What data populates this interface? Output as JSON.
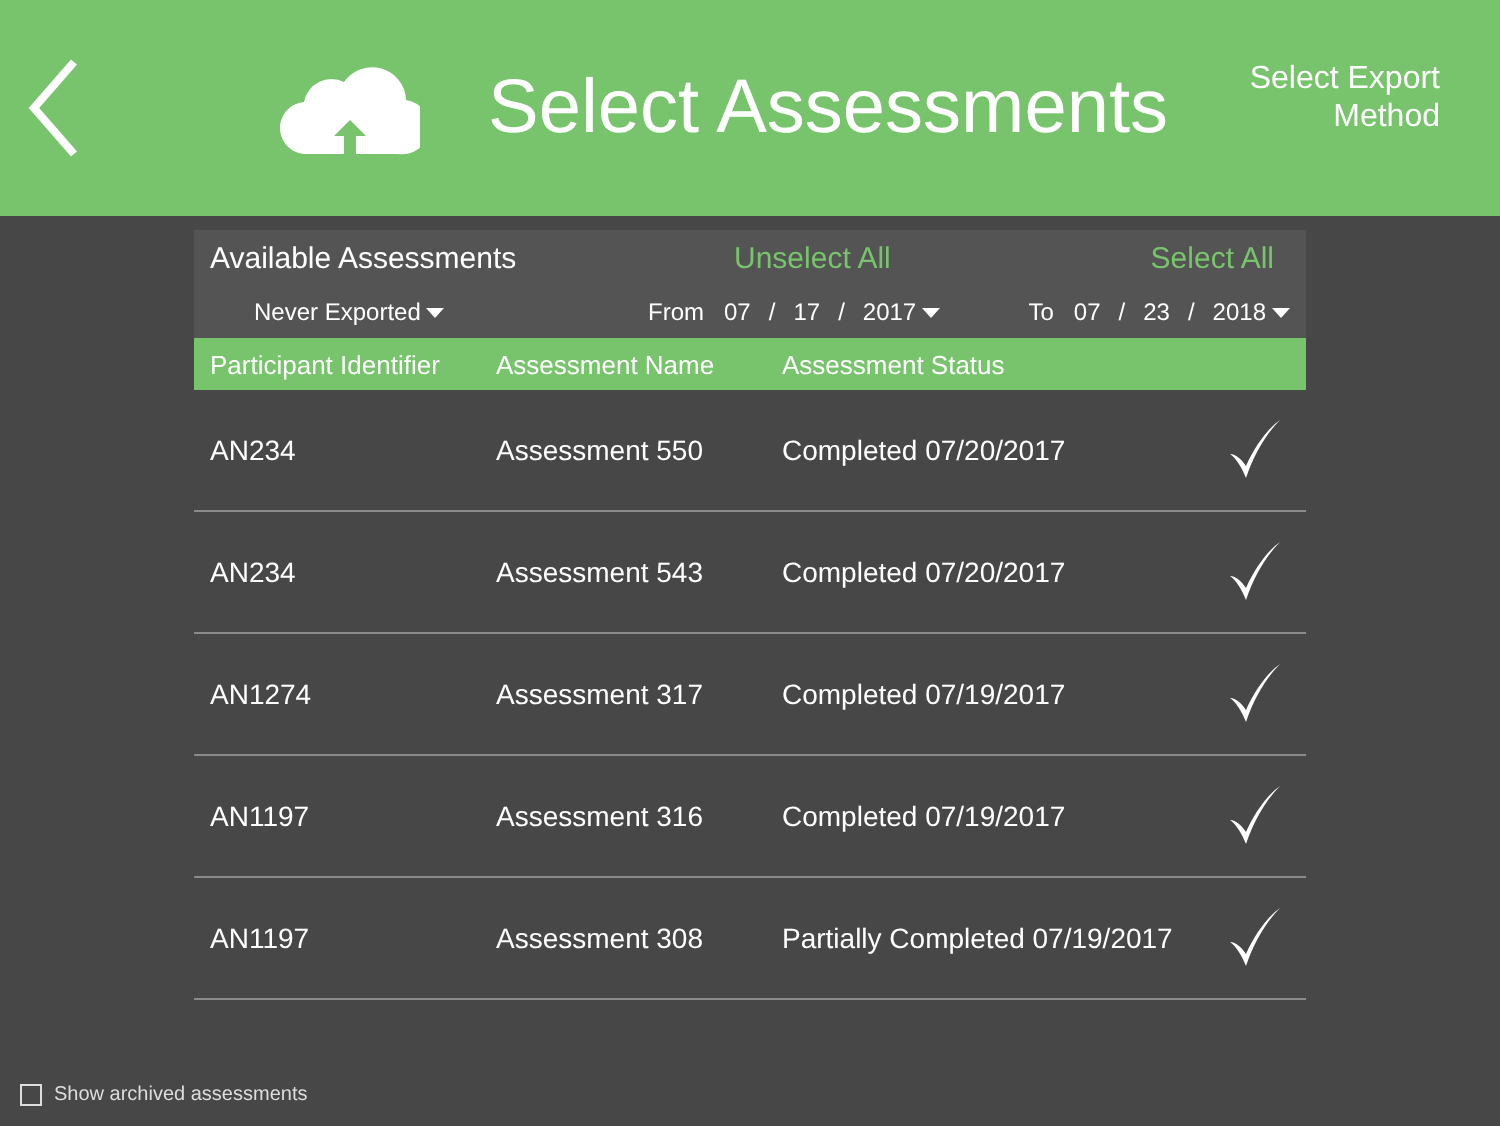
{
  "header": {
    "title": "Select Assessments",
    "action": "Select Export\nMethod"
  },
  "panel": {
    "title": "Available Assessments",
    "unselect_all": "Unselect All",
    "select_all": "Select All",
    "filter": {
      "label": "Never Exported"
    },
    "from": {
      "label": "From",
      "month": "07",
      "day": "17",
      "year": "2017"
    },
    "to": {
      "label": "To",
      "month": "07",
      "day": "23",
      "year": "2018"
    },
    "separator": "/"
  },
  "table": {
    "columns": [
      "Participant Identifier",
      "Assessment Name",
      "Assessment Status"
    ],
    "rows": [
      {
        "participant": "AN234",
        "name": "Assessment 550",
        "status": "Completed  07/20/2017",
        "selected": true
      },
      {
        "participant": "AN234",
        "name": "Assessment 543",
        "status": "Completed  07/20/2017",
        "selected": true
      },
      {
        "participant": "AN1274",
        "name": "Assessment 317",
        "status": "Completed  07/19/2017",
        "selected": true
      },
      {
        "participant": "AN1197",
        "name": "Assessment 316",
        "status": "Completed  07/19/2017",
        "selected": true
      },
      {
        "participant": "AN1197",
        "name": "Assessment 308",
        "status": "Partially Completed  07/19/2017",
        "selected": true
      }
    ]
  },
  "archived": {
    "label": "Show archived assessments",
    "checked": false
  }
}
